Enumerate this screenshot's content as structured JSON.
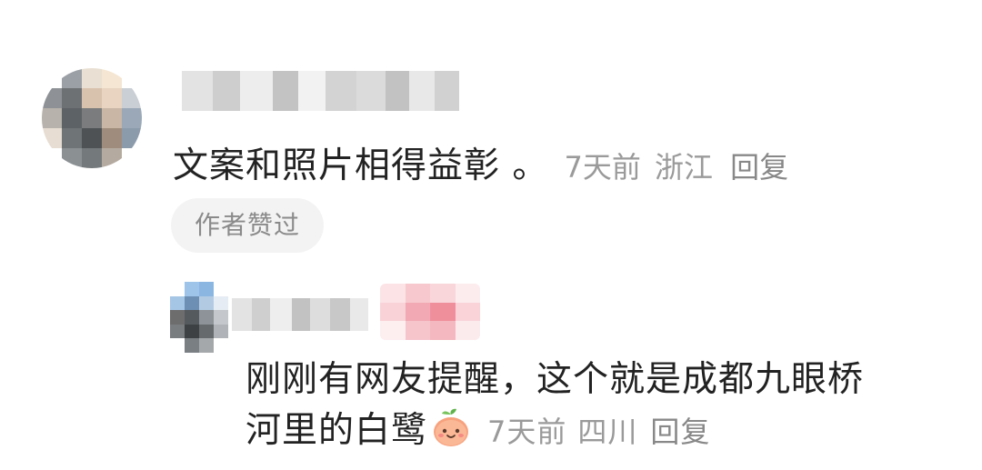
{
  "comment": {
    "avatar_icon": "user-avatar-blurred",
    "username_blurred": true,
    "text": "文案和照片相得益彰 。",
    "time": "7天前",
    "location": "浙江",
    "reply_label": "回复",
    "author_liked_label": "作者赞过"
  },
  "reply": {
    "avatar_icon": "user-avatar-blurred",
    "username_blurred": true,
    "badge_blurred": true,
    "text_line1": "刚刚有网友提醒，这个就是成都九眼桥",
    "text_line2": "河里的白鹭",
    "emoji": "peach-emoji",
    "time": "7天前",
    "location": "四川",
    "reply_label": "回复"
  },
  "colors": {
    "body_text": "#222222",
    "meta_text": "#9a9a9a",
    "badge_bg": "#f3f3f3"
  }
}
